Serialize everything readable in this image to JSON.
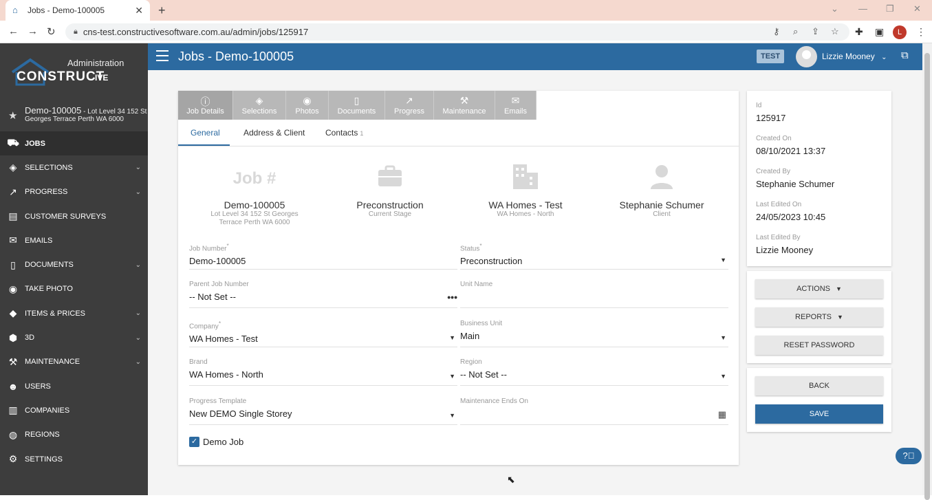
{
  "browser": {
    "tab_title": "Jobs - Demo-100005",
    "url": "cns-test.constructivesoftware.com.au/admin/jobs/125917",
    "profile_initial": "L"
  },
  "sidebar": {
    "logo_admin": "Administration",
    "logo_brand": "CONSTRUCT",
    "logo_brand_suffix": "IVE",
    "job_id": "Demo-100005",
    "job_address": " - Lot Level 34 152 St Georges Terrace Perth WA 6000",
    "items": [
      {
        "label": "JOBS",
        "icon": "truck-icon",
        "chevron": false
      },
      {
        "label": "SELECTIONS",
        "icon": "swatch-icon",
        "chevron": true
      },
      {
        "label": "PROGRESS",
        "icon": "trend-icon",
        "chevron": true
      },
      {
        "label": "CUSTOMER SURVEYS",
        "icon": "clipboard-icon",
        "chevron": false
      },
      {
        "label": "EMAILS",
        "icon": "envelope-icon",
        "chevron": false
      },
      {
        "label": "DOCUMENTS",
        "icon": "document-icon",
        "chevron": true
      },
      {
        "label": "TAKE PHOTO",
        "icon": "camera-icon",
        "chevron": false
      },
      {
        "label": "ITEMS & PRICES",
        "icon": "tag-icon",
        "chevron": true
      },
      {
        "label": "3D",
        "icon": "cube-icon",
        "chevron": true
      },
      {
        "label": "MAINTENANCE",
        "icon": "wrench-icon",
        "chevron": true
      },
      {
        "label": "USERS",
        "icon": "users-icon",
        "chevron": false
      },
      {
        "label": "COMPANIES",
        "icon": "building-icon",
        "chevron": false
      },
      {
        "label": "REGIONS",
        "icon": "map-pin-icon",
        "chevron": false
      },
      {
        "label": "SETTINGS",
        "icon": "gear-icon",
        "chevron": false
      }
    ]
  },
  "header": {
    "title": "Jobs - Demo-100005",
    "env_badge": "TEST",
    "username": "Lizzie Mooney"
  },
  "top_tabs": [
    {
      "label": "Job Details",
      "icon": "info-icon"
    },
    {
      "label": "Selections",
      "icon": "swatch-icon"
    },
    {
      "label": "Photos",
      "icon": "camera-icon"
    },
    {
      "label": "Documents",
      "icon": "document-icon"
    },
    {
      "label": "Progress",
      "icon": "trend-icon"
    },
    {
      "label": "Maintenance",
      "icon": "wrench-icon"
    },
    {
      "label": "Emails",
      "icon": "envelope-icon"
    }
  ],
  "sub_tabs": {
    "general": "General",
    "address_client": "Address & Client",
    "contacts": "Contacts",
    "contacts_count": "1"
  },
  "summary": {
    "job_icon_text": "Job #",
    "job_number": "Demo-100005",
    "job_address": "Lot Level 34 152 St Georges Terrace Perth WA 6000",
    "stage": "Preconstruction",
    "stage_sub": "Current Stage",
    "company": "WA Homes - Test",
    "company_sub": "WA Homes - North",
    "client": "Stephanie Schumer",
    "client_sub": "Client"
  },
  "form": {
    "job_number_label": "Job Number",
    "job_number": "Demo-100005",
    "status_label": "Status",
    "status": "Preconstruction",
    "parent_label": "Parent Job Number",
    "parent": "-- Not Set --",
    "unit_label": "Unit Name",
    "unit": "",
    "company_label": "Company",
    "company": "WA Homes - Test",
    "bu_label": "Business Unit",
    "bu": "Main",
    "brand_label": "Brand",
    "brand": "WA Homes - North",
    "region_label": "Region",
    "region": "-- Not Set --",
    "template_label": "Progress Template",
    "template": "New DEMO Single Storey",
    "maint_label": "Maintenance Ends On",
    "maint": "",
    "demo_label": "Demo Job",
    "required_mark": "*"
  },
  "info": {
    "id_label": "Id",
    "id": "125917",
    "created_on_label": "Created On",
    "created_on": "08/10/2021 13:37",
    "created_by_label": "Created By",
    "created_by": "Stephanie Schumer",
    "edited_on_label": "Last Edited On",
    "edited_on": "24/05/2023 10:45",
    "edited_by_label": "Last Edited By",
    "edited_by": "Lizzie Mooney"
  },
  "buttons": {
    "actions": "ACTIONS",
    "reports": "REPORTS",
    "reset_password": "RESET PASSWORD",
    "back": "BACK",
    "save": "SAVE"
  },
  "colors": {
    "primary": "#2c6aa0",
    "sidebar": "#3d3d3d",
    "tab_strip": "#f5d9cf"
  }
}
